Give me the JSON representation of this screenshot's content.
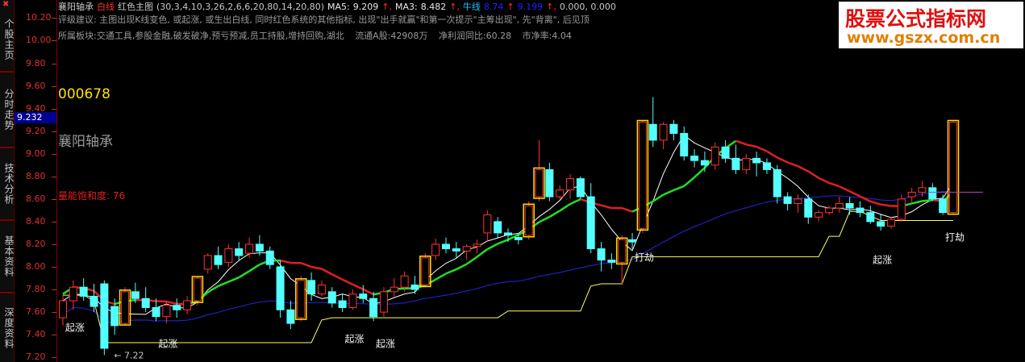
{
  "sidebar": {
    "tabs": [
      "个股主页",
      "分时走势",
      "技术分析",
      "基本资料",
      "深度资料"
    ]
  },
  "header": {
    "stock": "襄阳轴承",
    "indicator_name": "白线",
    "formula_name": "红色主图",
    "params": "(30,3,4,10,3,26,2,6,6,20,80,14,20,80)",
    "ma5_label": "MA5:",
    "ma5_value": "9.209",
    "ma3_label": "MA3:",
    "ma3_value": "8.482",
    "line3_label": "牛线",
    "line3_value": "8.74",
    "line4_value": "9.199",
    "tail_values": "0.000, 0.000"
  },
  "info": {
    "advice": "评级建议: 主图出现K线变色, 或起涨, 或生出白线, 同时红色系统的其他指标, 出现\"出手就赢\"和第一次提示\"主筹出现\", 先\"背离\", 后见顶",
    "sectors": "所属板块:交通工具,参股金融,破发破净,预亏预减,员工持股,增持回购,湖北",
    "float": "流通A股:42908万",
    "profit": "净利润同比:60.28",
    "pb": "市净率:4.04"
  },
  "stock_code": "000678",
  "stock_name": "襄阳轴承",
  "saturation": "量能饱和度: 76",
  "current_price": "9.232",
  "low_price_label": "7.22",
  "watermark": {
    "title": "股票公式指标网",
    "url": "www.gszx.com.cn"
  },
  "colors": {
    "up": "#ff3232",
    "down": "#54ffff",
    "ma_blue": "#2020c0",
    "ma_yellow": "#ffff60",
    "ma_white": "#ffffff",
    "signal_green": "#20e020",
    "signal_red": "#e02020",
    "box_yellow": "#ffe000"
  },
  "chart_data": {
    "type": "candlestick",
    "y_ticks": [
      "10.20",
      "10.00",
      "9.80",
      "9.60",
      "9.40",
      "9.20",
      "9.00",
      "8.80",
      "8.60",
      "8.40",
      "8.20",
      "8.00",
      "7.80",
      "7.60",
      "7.40",
      "7.20"
    ],
    "ylim": [
      7.18,
      10.26
    ],
    "candles": [
      [
        7.55,
        7.75,
        7.48,
        7.7
      ],
      [
        7.7,
        7.88,
        7.62,
        7.82
      ],
      [
        7.82,
        7.9,
        7.7,
        7.74
      ],
      [
        7.74,
        7.85,
        7.6,
        7.65
      ],
      [
        7.85,
        7.88,
        7.22,
        7.28
      ],
      [
        7.65,
        7.72,
        7.4,
        7.48
      ],
      [
        7.5,
        7.82,
        7.48,
        7.78
      ],
      [
        7.78,
        7.86,
        7.68,
        7.72
      ],
      [
        7.72,
        7.82,
        7.6,
        7.64
      ],
      [
        7.64,
        7.72,
        7.52,
        7.56
      ],
      [
        7.56,
        7.7,
        7.5,
        7.66
      ],
      [
        7.66,
        7.72,
        7.55,
        7.62
      ],
      [
        7.62,
        7.74,
        7.58,
        7.7
      ],
      [
        7.7,
        7.92,
        7.66,
        7.9
      ],
      [
        7.98,
        8.12,
        7.94,
        8.1
      ],
      [
        8.1,
        8.18,
        7.98,
        8.02
      ],
      [
        8.04,
        8.2,
        8.0,
        8.16
      ],
      [
        8.16,
        8.22,
        8.06,
        8.1
      ],
      [
        8.12,
        8.26,
        8.08,
        8.2
      ],
      [
        8.2,
        8.28,
        8.1,
        8.14
      ],
      [
        8.14,
        8.18,
        7.98,
        8.02
      ],
      [
        8.0,
        8.06,
        7.55,
        7.62
      ],
      [
        7.62,
        7.7,
        7.45,
        7.5
      ],
      [
        7.55,
        7.92,
        7.52,
        7.88
      ],
      [
        7.88,
        7.95,
        7.7,
        7.76
      ],
      [
        7.76,
        7.88,
        7.74,
        7.84
      ],
      [
        7.78,
        7.82,
        7.64,
        7.68
      ],
      [
        7.7,
        7.76,
        7.6,
        7.64
      ],
      [
        7.64,
        7.8,
        7.62,
        7.76
      ],
      [
        7.76,
        7.84,
        7.68,
        7.72
      ],
      [
        7.72,
        7.78,
        7.52,
        7.56
      ],
      [
        7.6,
        7.82,
        7.56,
        7.78
      ],
      [
        7.78,
        7.9,
        7.74,
        7.82
      ],
      [
        7.82,
        7.96,
        7.78,
        7.92
      ],
      [
        7.84,
        7.92,
        7.76,
        7.8
      ],
      [
        7.84,
        8.12,
        7.82,
        8.08
      ],
      [
        8.1,
        8.25,
        8.06,
        8.2
      ],
      [
        8.2,
        8.26,
        8.12,
        8.16
      ],
      [
        8.16,
        8.22,
        8.08,
        8.14
      ],
      [
        8.14,
        8.2,
        8.06,
        8.18
      ],
      [
        8.18,
        8.24,
        8.12,
        8.2
      ],
      [
        8.3,
        8.5,
        8.22,
        8.46
      ],
      [
        8.4,
        8.44,
        8.26,
        8.3
      ],
      [
        8.3,
        8.34,
        8.22,
        8.28
      ],
      [
        8.26,
        8.3,
        8.2,
        8.24
      ],
      [
        8.28,
        8.58,
        8.24,
        8.54
      ],
      [
        8.62,
        9.12,
        8.58,
        8.86
      ],
      [
        8.86,
        8.92,
        8.58,
        8.62
      ],
      [
        8.62,
        8.72,
        8.6,
        8.68
      ],
      [
        8.68,
        8.82,
        8.6,
        8.78
      ],
      [
        8.78,
        8.8,
        8.6,
        8.62
      ],
      [
        8.62,
        8.74,
        8.12,
        8.16
      ],
      [
        8.16,
        8.22,
        7.96,
        8.06
      ],
      [
        8.06,
        8.12,
        7.98,
        8.04
      ],
      [
        8.04,
        8.28,
        7.84,
        8.24
      ],
      [
        8.24,
        8.3,
        8.16,
        8.22
      ],
      [
        8.34,
        9.3,
        8.3,
        9.28
      ],
      [
        9.26,
        9.5,
        9.06,
        9.12
      ],
      [
        9.12,
        9.28,
        9.04,
        9.26
      ],
      [
        9.26,
        9.3,
        9.12,
        9.18
      ],
      [
        9.18,
        9.24,
        8.94,
        8.98
      ],
      [
        8.98,
        9.04,
        8.88,
        8.94
      ],
      [
        8.94,
        9.02,
        8.84,
        8.9
      ],
      [
        8.9,
        9.1,
        8.86,
        9.06
      ],
      [
        9.06,
        9.12,
        8.92,
        8.96
      ],
      [
        8.96,
        9.08,
        8.82,
        8.86
      ],
      [
        8.86,
        9.0,
        8.82,
        8.96
      ],
      [
        8.96,
        9.02,
        8.8,
        8.92
      ],
      [
        8.92,
        8.96,
        8.82,
        8.86
      ],
      [
        8.86,
        8.9,
        8.56,
        8.62
      ],
      [
        8.62,
        8.66,
        8.5,
        8.56
      ],
      [
        8.56,
        8.64,
        8.48,
        8.6
      ],
      [
        8.6,
        8.64,
        8.38,
        8.44
      ],
      [
        8.44,
        8.5,
        8.4,
        8.48
      ],
      [
        8.48,
        8.54,
        8.46,
        8.52
      ],
      [
        8.52,
        8.62,
        8.48,
        8.56
      ],
      [
        8.56,
        8.62,
        8.46,
        8.52
      ],
      [
        8.52,
        8.58,
        8.44,
        8.48
      ],
      [
        8.48,
        8.54,
        8.38,
        8.4
      ],
      [
        8.4,
        8.46,
        8.32,
        8.36
      ],
      [
        8.36,
        8.44,
        8.34,
        8.42
      ],
      [
        8.42,
        8.64,
        8.4,
        8.6
      ],
      [
        8.62,
        8.7,
        8.56,
        8.66
      ],
      [
        8.66,
        8.76,
        8.62,
        8.7
      ],
      [
        8.7,
        8.74,
        8.58,
        8.6
      ],
      [
        8.6,
        8.64,
        8.46,
        8.48
      ],
      [
        8.48,
        9.3,
        8.46,
        9.28
      ]
    ],
    "annotations": [
      "起涨",
      "起涨",
      "起涨",
      "起涨",
      "起涨",
      "打劫",
      "打劫"
    ]
  }
}
